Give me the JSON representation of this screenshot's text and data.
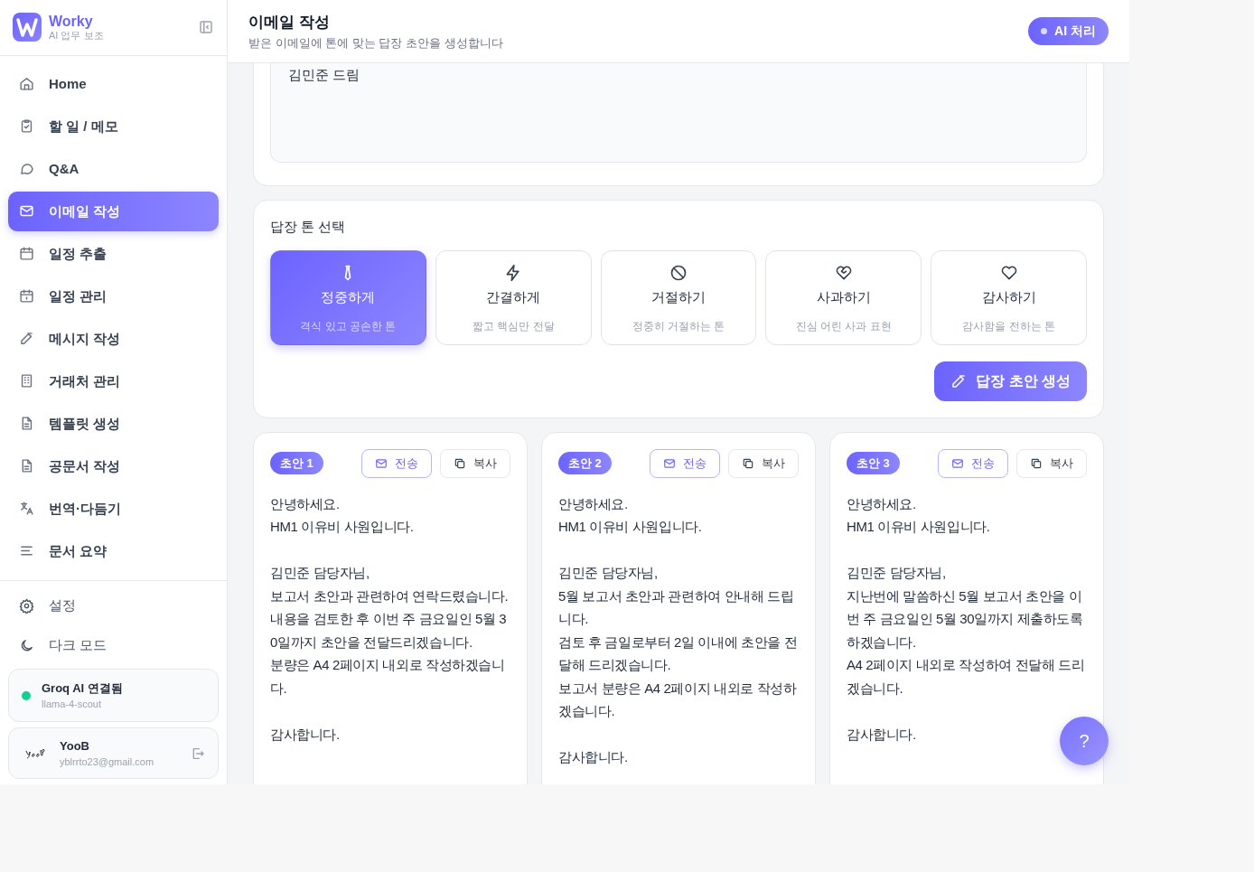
{
  "brand": {
    "name": "Worky",
    "tagline": "AI 업무 보조"
  },
  "sidebar": {
    "items": [
      {
        "label": "Home",
        "selected": false
      },
      {
        "label": "할 일 / 메모",
        "selected": false
      },
      {
        "label": "Q&A",
        "selected": false
      },
      {
        "label": "이메일 작성",
        "selected": true
      },
      {
        "label": "일정 추출",
        "selected": false
      },
      {
        "label": "일정 관리",
        "selected": false
      },
      {
        "label": "메시지 작성",
        "selected": false
      },
      {
        "label": "거래처 관리",
        "selected": false
      },
      {
        "label": "템플릿 생성",
        "selected": false
      },
      {
        "label": "공문서 작성",
        "selected": false
      },
      {
        "label": "번역·다듬기",
        "selected": false
      },
      {
        "label": "문서 요약",
        "selected": false
      }
    ],
    "bottom_items": [
      {
        "label": "설정"
      },
      {
        "label": "다크 모드"
      }
    ],
    "status": {
      "title": "Groq AI 연결됨",
      "model": "llama-4-scout",
      "connected": true
    },
    "user": {
      "name": "YooB",
      "email": "yblrrto23@gmail.com"
    }
  },
  "header": {
    "title": "이메일 작성",
    "subtitle": "받은 이메일에 톤에 맞는 답장 초안을 생성합니다",
    "badge": "AI 처리"
  },
  "email_input": {
    "value": "김민준 드림"
  },
  "tone_section": {
    "title": "답장 톤 선택",
    "tones": [
      {
        "label": "정중하게",
        "description": "격식 있고 공손한 톤",
        "selected": true
      },
      {
        "label": "간결하게",
        "description": "짧고 핵심만 전달",
        "selected": false
      },
      {
        "label": "거절하기",
        "description": "정중히 거절하는 톤",
        "selected": false
      },
      {
        "label": "사과하기",
        "description": "진심 어린 사과 표현",
        "selected": false
      },
      {
        "label": "감사하기",
        "description": "감사함을 전하는 톤",
        "selected": false
      }
    ],
    "generate_button": "답장 초안 생성"
  },
  "drafts": [
    {
      "badge": "초안 1",
      "send": "전송",
      "copy": "복사",
      "paragraphs": [
        "안녕하세요.\nHM1 이유비 사원입니다.",
        "김민준 담당자님,\n보고서 초안과 관련하여 연락드렸습니다.\n내용을 검토한 후 이번 주 금요일인 5월 30일까지 초안을 전달드리겠습니다.\n분량은 A4 2페이지 내외로 작성하겠습니다.",
        "감사합니다."
      ]
    },
    {
      "badge": "초안 2",
      "send": "전송",
      "copy": "복사",
      "paragraphs": [
        "안녕하세요.\nHM1 이유비 사원입니다.",
        "김민준 담당자님,\n5월 보고서 초안과 관련하여 안내해 드립니다.\n검토 후 금일로부터 2일 이내에 초안을 전달해 드리겠습니다.\n보고서 분량은 A4 2페이지 내외로 작성하겠습니다.",
        "감사합니다."
      ]
    },
    {
      "badge": "초안 3",
      "send": "전송",
      "copy": "복사",
      "paragraphs": [
        "안녕하세요.\nHM1 이유비 사원입니다.",
        "김민준 담당자님,\n지난번에 말씀하신 5월 보고서 초안을 이번 주 금요일인 5월 30일까지 제출하도록 하겠습니다.\nA4 2페이지 내외로 작성하여 전달해 드리겠습니다.",
        "감사합니다."
      ]
    }
  ],
  "help_button": "?"
}
